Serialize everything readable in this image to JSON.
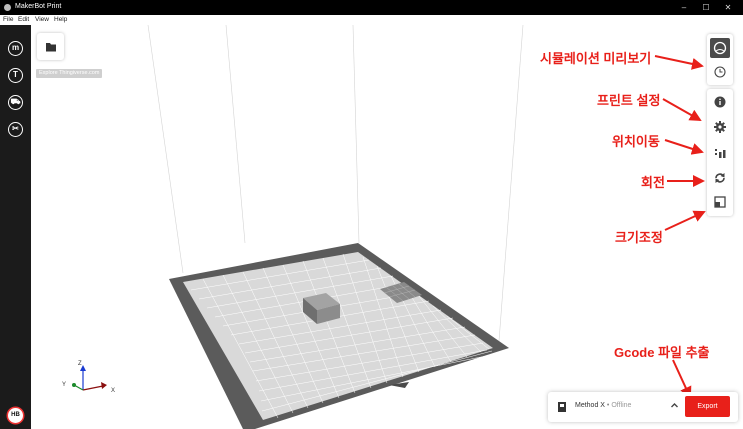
{
  "window": {
    "title": "MakerBot Print",
    "controls": [
      "–",
      "☐",
      "✕"
    ]
  },
  "menu": [
    "File",
    "Edit",
    "View",
    "Help"
  ],
  "sidebar": {
    "items": [
      {
        "icon": "makerbot-logo-icon",
        "glyph": "m"
      },
      {
        "icon": "thingiverse-icon",
        "glyph": "T"
      },
      {
        "icon": "store-cart-icon",
        "glyph": "⛟"
      },
      {
        "icon": "tools-icon",
        "glyph": "✂"
      }
    ],
    "avatar": "HB",
    "tooltip": "Explore Thingiverse.com"
  },
  "annotations": {
    "preview": "시뮬레이션 미리보기",
    "settings": "프린트 설정",
    "move": "위치이동",
    "rotate": "회전",
    "scale": "크기조정",
    "export": "Gcode 파일 추출"
  },
  "axes": {
    "x": "X",
    "y": "Y",
    "z": "Z"
  },
  "printer": {
    "name": "Method X",
    "separator": " • ",
    "status": "Offline",
    "export_label": "Export"
  },
  "colors": {
    "accent": "#e8201a",
    "sidebar": "#1b1b1b",
    "plate_border": "#5b5b5b",
    "plate_surface": "#d9d9d9"
  }
}
